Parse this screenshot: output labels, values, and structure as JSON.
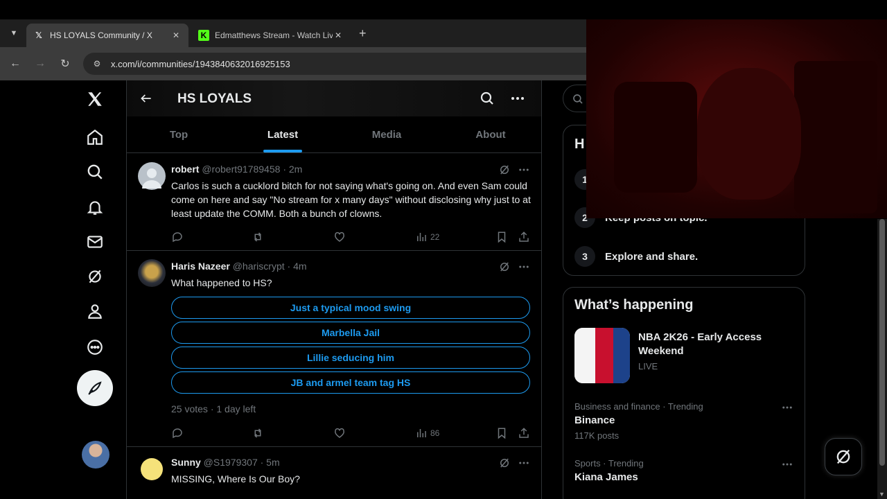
{
  "browser": {
    "tabs": [
      {
        "title": "HS LOYALS Community / X",
        "favicon": "X",
        "active": true
      },
      {
        "title": "Edmatthews Stream - Watch Live",
        "favicon": "K",
        "active": false
      }
    ],
    "url": "x.com/i/communities/1943840632016925153"
  },
  "community": {
    "title": "HS LOYALS",
    "tabs": [
      "Top",
      "Latest",
      "Media",
      "About"
    ],
    "active_tab": "Latest"
  },
  "posts": [
    {
      "name": "robert",
      "handle": "@robert91789458",
      "time": "· 2m",
      "text": "Carlos is such a cucklord bitch for not saying what's going on. And even Sam could come on here and say \"No stream for x many days\" without disclosing why just to at least update the COMM. Both a bunch of clowns.",
      "views": "22"
    },
    {
      "name": "Haris Nazeer",
      "handle": "@hariscrypt",
      "time": "· 4m",
      "text": "What happened to HS?",
      "poll": [
        "Just a typical mood swing",
        "Marbella Jail",
        "Lillie seducing him",
        "JB and armel team tag HS"
      ],
      "poll_footer": "25 votes · 1 day left",
      "views": "86"
    },
    {
      "name": "Sunny",
      "handle": "@S1979307",
      "time": "· 5m",
      "text": "MISSING, Where Is Our Boy?"
    }
  ],
  "rules": {
    "title": "H",
    "items": [
      {
        "num": "1",
        "text": ""
      },
      {
        "num": "2",
        "text": "Keep posts on topic."
      },
      {
        "num": "3",
        "text": "Explore and share."
      }
    ]
  },
  "happening": {
    "title": "What’s happening",
    "featured": {
      "title": "NBA 2K26 - Early Access Weekend",
      "status": "LIVE"
    },
    "trends": [
      {
        "category": "Business and finance · Trending",
        "name": "Binance",
        "count": "117K posts"
      },
      {
        "category": "Sports · Trending",
        "name": "Kiana James",
        "count": ""
      }
    ]
  },
  "colors": {
    "accent": "#1d9bf0",
    "border": "#2f3336",
    "muted": "#71767b"
  }
}
